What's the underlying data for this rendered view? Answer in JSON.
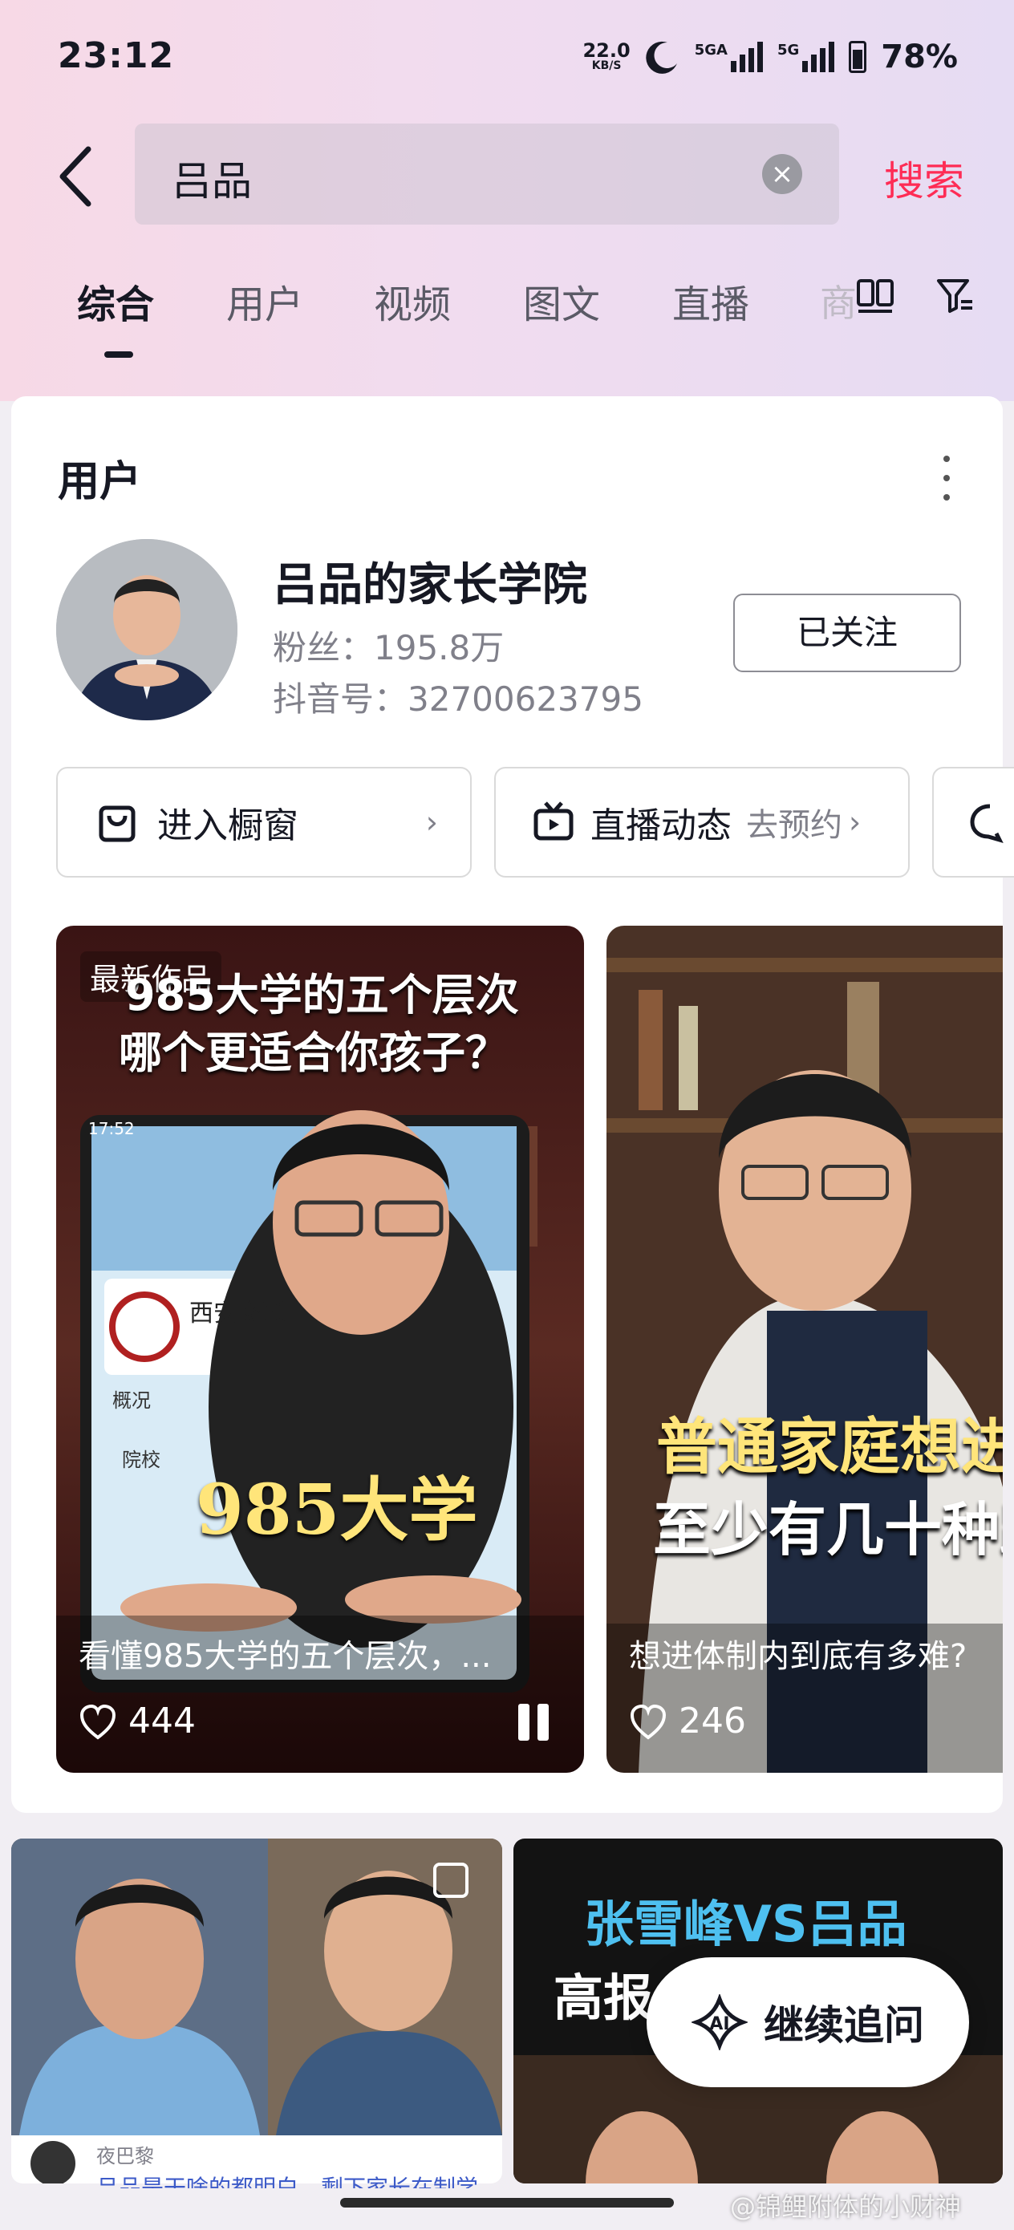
{
  "status_bar": {
    "time": "23:12",
    "net_speed": "22.0",
    "net_speed_unit": "KB/S",
    "signal1": "5GA",
    "signal2": "5G",
    "battery": "78%"
  },
  "search": {
    "query": "吕品",
    "submit_label": "搜索"
  },
  "tabs": [
    {
      "label": "综合",
      "active": true
    },
    {
      "label": "用户"
    },
    {
      "label": "视频"
    },
    {
      "label": "图文"
    },
    {
      "label": "直播"
    },
    {
      "label": "商"
    }
  ],
  "user_section": {
    "title": "用户",
    "name": "吕品的家长学院",
    "fans": "粉丝：195.8万",
    "douyin_id": "抖音号：32700623795",
    "follow_label": "已关注",
    "actions": [
      {
        "label": "进入橱窗",
        "icon": "bag-icon"
      },
      {
        "label": "直播动态",
        "sub": "去预约",
        "icon": "tv-icon"
      }
    ]
  },
  "videos": [
    {
      "badge": "最新作品",
      "overlay_line1": "985大学的五个层次",
      "overlay_line2": "哪个更适合你孩子？",
      "big_text": "985大学",
      "screen_text": "西安交通",
      "screen_tab": "概况",
      "screen_item": "院校",
      "phone_time": "17:52",
      "caption": "看懂985大学的五个层次，...",
      "likes": "444"
    },
    {
      "overlay_line1": "普通家庭想进体",
      "overlay_line2": "至少有几十种路",
      "caption": "想进体制内到底有多难?",
      "likes": "246"
    }
  ],
  "bottom": {
    "left_author": "夜巴黎",
    "left_desc": "吕品是干啥的都明白，剩下家长在制学",
    "right_title1": "张雪峰VS吕品",
    "right_title2": "高报",
    "ai_button": "继续追问",
    "ai_badge": "AI"
  },
  "watermark": "@锦鲤附体的小财神",
  "colors": {
    "accent": "#fe2c55",
    "text": "#161823",
    "secondary": "#80808a"
  }
}
